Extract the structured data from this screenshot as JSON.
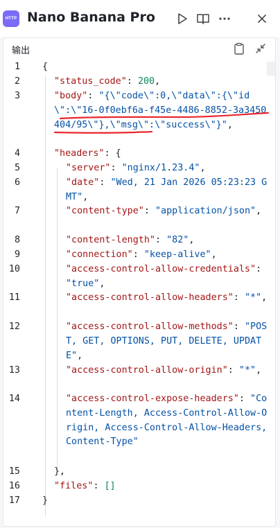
{
  "app": {
    "icon_text": "HTTP",
    "title": "Nano Banana Pro"
  },
  "header_icons": [
    "play-icon",
    "book-icon",
    "more-icon",
    "close-icon"
  ],
  "panel": {
    "label": "输出",
    "icons": [
      "clipboard-icon",
      "collapse-icon"
    ]
  },
  "code": {
    "line_numbers": [
      "1",
      "2",
      "3",
      "4",
      "5",
      "6",
      "7",
      "8",
      "9",
      "10",
      "11",
      "12",
      "13",
      "14",
      "15",
      "16",
      "17"
    ],
    "l1": "{",
    "l2_key": "\"status_code\"",
    "l2_val": "200",
    "l3_key": "\"body\"",
    "l3_val": "\"{\\\"code\\\":0,\\\"data\\\":{\\\"id\\\":\\\"16-0f0ebf6a-f45e-4486-8852-3a3450404/95\\\"},\\\"msg\\\":\\\"success\\\"}\"",
    "l4_key": "\"headers\"",
    "l5_key": "\"server\"",
    "l5_val": "\"nginx/1.23.4\"",
    "l6_key": "\"date\"",
    "l6_val": "\"Wed, 21 Jan 2026 05:23:23 GMT\"",
    "l7_key": "\"content-type\"",
    "l7_val": "\"application/json\"",
    "l8_key": "\"content-length\"",
    "l8_val": "\"82\"",
    "l9_key": "\"connection\"",
    "l9_val": "\"keep-alive\"",
    "l10_key": "\"access-control-allow-credentials\"",
    "l10_val": "\"true\"",
    "l11_key": "\"access-control-allow-headers\"",
    "l11_val": "\"*\"",
    "l12_key": "\"access-control-allow-methods\"",
    "l12_val": "\"POST, GET, OPTIONS, PUT, DELETE, UPDATE\"",
    "l13_key": "\"access-control-allow-origin\"",
    "l13_val": "\"*\"",
    "l14_key": "\"access-control-expose-headers\"",
    "l14_val": "\"Content-Length, Access-Control-Allow-Origin, Access-Control-Allow-Headers, Content-Type\"",
    "l15": "},",
    "l16_key": "\"files\"",
    "l16_val": "[]",
    "l17": "}"
  },
  "colors": {
    "key": "#a31515",
    "string": "#0451a5",
    "number": "#098658",
    "annotation": "#e8262d",
    "accent": "#7b6cf6"
  }
}
